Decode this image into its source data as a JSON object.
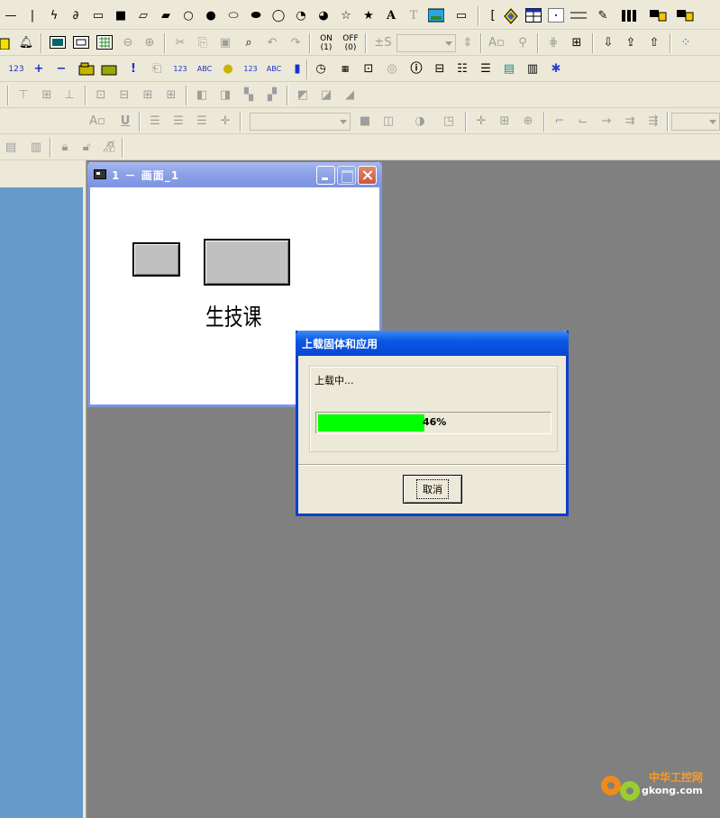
{
  "child_window": {
    "title": "1 － 画面_1",
    "canvas_label": "生技课"
  },
  "dialog": {
    "title": "上载固体和应用",
    "status": "上载中...",
    "progress_fraction": 0.46,
    "progress_text": "46%",
    "cancel_label": "取消"
  },
  "toolbar": {
    "on_label": "ON",
    "off_label": "OFF",
    "size_label": "±S",
    "row3_text_icons": [
      "123",
      "ABC"
    ]
  },
  "watermark": {
    "cn": "中华工控网",
    "url": "gkong.com"
  },
  "colors": {
    "workspace": "#808080",
    "left_panel": "#6699cc",
    "progress_fill": "#00ff00",
    "dialog_caption": "#0a58e6",
    "child_caption": "#8ca1e8"
  }
}
